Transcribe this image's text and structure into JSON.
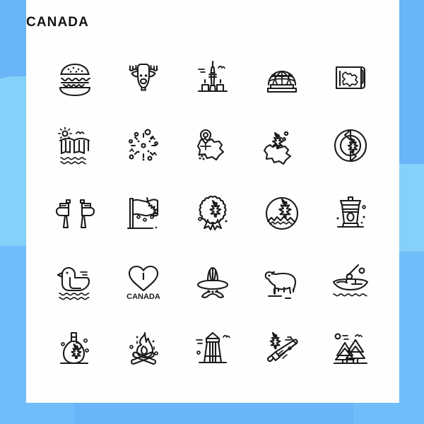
{
  "page": {
    "title": "CANADA",
    "background_color": "#6AB4F8",
    "accent_light": "#85D1FA",
    "accent_mid": "#6FBDF9",
    "card_color": "#FEFEFE",
    "line_color": "#1A1A1A"
  },
  "heart_icon": {
    "letter": "I",
    "caption": "CANADA"
  },
  "grid": {
    "columns": 5,
    "rows": 5,
    "icons": [
      {
        "name": "burger-icon",
        "label": "Burger"
      },
      {
        "name": "moose-head-icon",
        "label": "Moose Head"
      },
      {
        "name": "cn-tower-icon",
        "label": "CN Tower"
      },
      {
        "name": "biosphere-dome-icon",
        "label": "Biosphere Dome"
      },
      {
        "name": "canada-map-scroll-icon",
        "label": "Canada Map Scroll"
      },
      {
        "name": "waterfall-icon",
        "label": "Niagara Falls"
      },
      {
        "name": "fireworks-icon",
        "label": "Fireworks"
      },
      {
        "name": "map-pin-canada-icon",
        "label": "Canada Map With Pin"
      },
      {
        "name": "canada-map-leaf-icon",
        "label": "Canada Map With Maple Leaf"
      },
      {
        "name": "maple-leaf-arrows-icon",
        "label": "Maple Leaf In Arrows Circle"
      },
      {
        "name": "two-axes-icon",
        "label": "Crossed Axes"
      },
      {
        "name": "canada-flag-icon",
        "label": "Canadian Flag"
      },
      {
        "name": "maple-leaf-award-icon",
        "label": "Maple Leaf Award Rosette"
      },
      {
        "name": "maple-leaf-badge-icon",
        "label": "Maple Leaf Mountain Badge"
      },
      {
        "name": "coffee-cup-icon",
        "label": "Coffee Cup"
      },
      {
        "name": "duck-water-icon",
        "label": "Duck On Water"
      },
      {
        "name": "i-love-canada-icon",
        "label": "I Love Canada Heart"
      },
      {
        "name": "mountie-hat-icon",
        "label": "Mountie Hat With Moustache"
      },
      {
        "name": "polar-bear-icon",
        "label": "Polar Bear"
      },
      {
        "name": "canoe-paddle-icon",
        "label": "Canoe With Paddle"
      },
      {
        "name": "maple-syrup-bottle-icon",
        "label": "Maple Syrup Bottle"
      },
      {
        "name": "campfire-icon",
        "label": "Campfire"
      },
      {
        "name": "totem-tower-icon",
        "label": "Totem Tower"
      },
      {
        "name": "trumpet-leaf-icon",
        "label": "Trumpet With Maple Leaf"
      },
      {
        "name": "pine-trees-icon",
        "label": "Pine Trees"
      }
    ]
  }
}
